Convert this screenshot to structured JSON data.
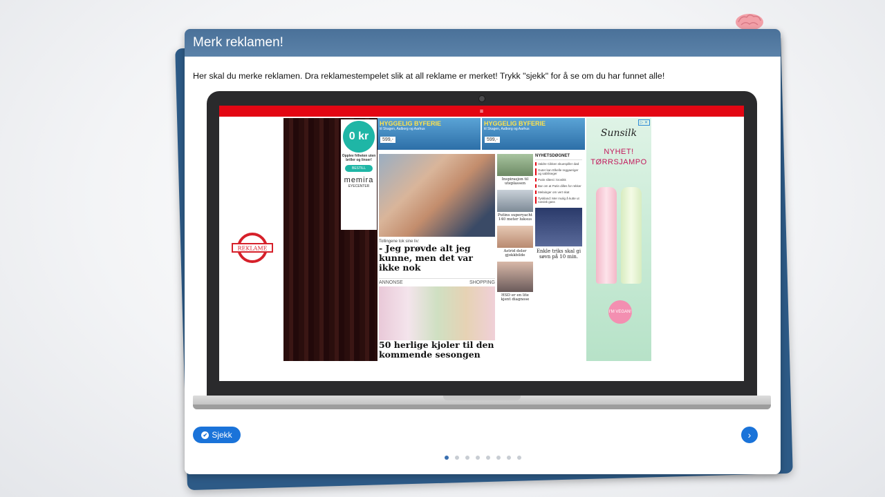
{
  "header": {
    "title": "Merk reklamen!"
  },
  "instructions": "Her skal du merke reklamen. Dra reklamestempelet slik at all reklame er merket! Trykk \"sjekk\" for å se om du har funnet alle!",
  "stamp": {
    "label": "REKLAME"
  },
  "website": {
    "menu_icon": "≡",
    "ad_left": {
      "price": "0 kr",
      "text1": "Opplev friheten uten briller og linser!",
      "cta": "BESTILL",
      "brand": "memira",
      "brand_sub": "EYECENTER"
    },
    "banners": [
      {
        "title": "HYGGELIG BYFERIE",
        "sub": "til Skagen, Aalborg og Aarhus",
        "price": "599,-"
      },
      {
        "title": "HYGGELIG BYFERIE",
        "sub": "til Skagen, Aalborg og Aarhus",
        "price": "599,-"
      }
    ],
    "main_article": {
      "kicker": "Tollingene tok sine liv:",
      "headline": "- Jeg prøvde alt jeg kunne, men det var ikke nok"
    },
    "shopping": {
      "label_left": "ANNONSE",
      "label_right": "SHOPPING",
      "headline": "50 herlige kjoler til den kommende sesongen"
    },
    "side_articles": [
      "Inspirasjon til uteplassen",
      "Putins superyacht 140 meter luksus",
      "Astrid deler gjokkbilde",
      "HSD er en lite kjent diagnose"
    ],
    "news": {
      "header": "NYHETSDØGNET",
      "items": [
        "Valdre Cikken skuespiller død",
        "Guter kan Elkelle reggaeriger og sabiliseger",
        "Putin sliteni i kronikk",
        "Bar om at Putin dilles for rekker",
        "Melainger om vert skat",
        "Tyskland: Mer mulig å kutte ut russisk gass"
      ],
      "caption": "Enkle triks skal gi søvn på 10 min."
    },
    "ad_right": {
      "brand": "Sunsilk",
      "line1": "NYHET!",
      "line2": "TØRRSJAMPO",
      "badge": "I'M VEGAN!",
      "adchoices": "▷ ✕"
    }
  },
  "controls": {
    "check_label": "Sjekk",
    "check_icon": "✔",
    "next_icon": "›",
    "pagination": {
      "total": 8,
      "current": 1
    }
  },
  "colors": {
    "header": "#4a7199",
    "button": "#1a73d9",
    "topbar": "#e30613"
  }
}
